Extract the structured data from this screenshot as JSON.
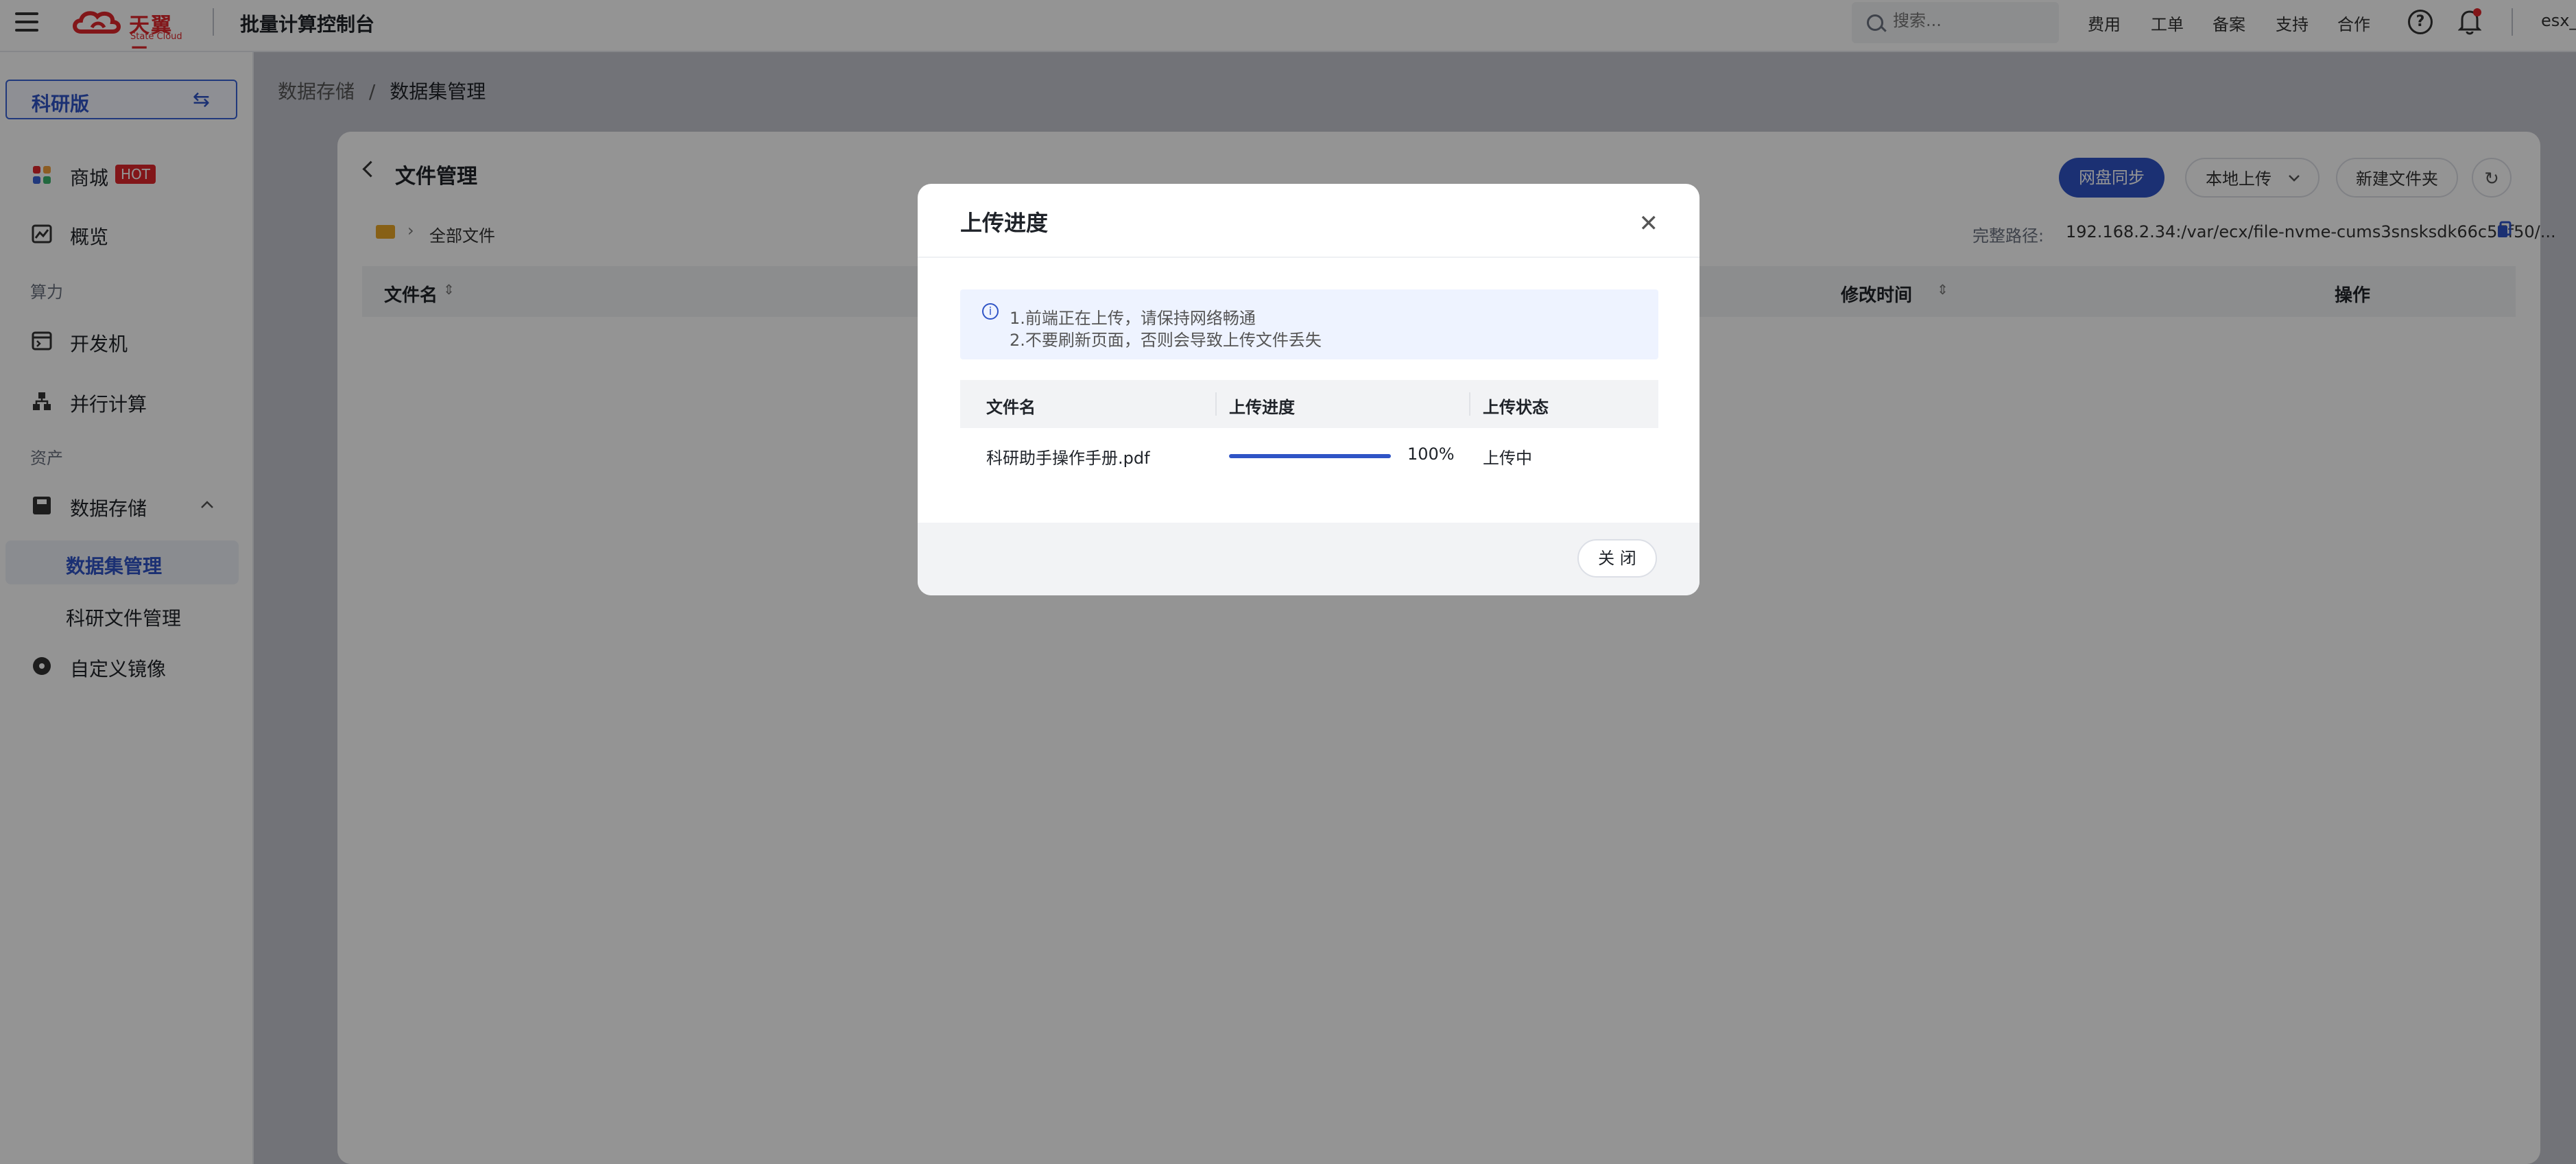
{
  "topbar": {
    "logo_name": "天翼云",
    "logo_sub": "State Cloud",
    "console_title": "批量计算控制台",
    "search_placeholder": "搜索...",
    "links": [
      "费用",
      "工单",
      "备案",
      "支持",
      "合作"
    ],
    "user": "esx_"
  },
  "sidebar": {
    "edition": "科研版",
    "items": {
      "mall": "商城",
      "hot_badge": "HOT",
      "overview": "概览",
      "group_compute": "算力",
      "dev_machine": "开发机",
      "parallel": "并行计算",
      "group_assets": "资产",
      "storage": "数据存储",
      "dataset_mgmt": "数据集管理",
      "research_files": "科研文件管理",
      "custom_image": "自定义镜像"
    }
  },
  "breadcrumb": {
    "parent": "数据存储",
    "separator": "/",
    "current": "数据集管理"
  },
  "file_mgmt": {
    "title": "文件管理",
    "buttons": {
      "sync": "网盘同步",
      "local_upload": "本地上传",
      "new_folder": "新建文件夹"
    },
    "folder_path": "全部文件",
    "full_path_label": "完整路径:",
    "full_path_value": "192.168.2.34:/var/ecx/file-nvme-cums3snsksdk66c57f50/...",
    "columns": {
      "name": "文件名",
      "modified": "修改时间",
      "actions": "操作"
    }
  },
  "modal": {
    "title": "上传进度",
    "notice": [
      "1.前端正在上传，请保持网络畅通",
      "2.不要刷新页面，否则会导致上传文件丢失"
    ],
    "columns": {
      "name": "文件名",
      "progress": "上传进度",
      "status": "上传状态"
    },
    "rows": [
      {
        "name": "科研助手操作手册.pdf",
        "progress_text": "100%",
        "progress_value": 100,
        "status": "上传中"
      }
    ],
    "close_label": "关 闭"
  },
  "colors": {
    "primary": "#2f54c6",
    "brand_red": "#e0262b",
    "folder": "#e9a626"
  }
}
